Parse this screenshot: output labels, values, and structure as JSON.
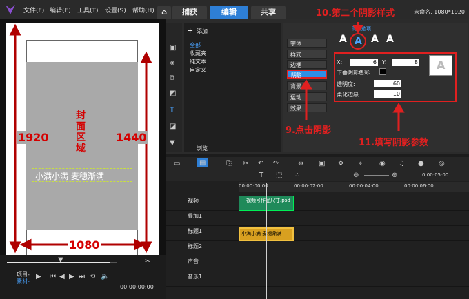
{
  "menu": {
    "file": "文件(F)",
    "edit": "编辑(E)",
    "tools": "工具(T)",
    "settings": "设置(S)",
    "help": "帮助(H)"
  },
  "tabs": {
    "capture": "捕获",
    "edit": "编辑",
    "share": "共享"
  },
  "title_right": "未命名, 1080*1920",
  "preview": {
    "height_left": "1920",
    "height_right": "1440",
    "width_label": "1080",
    "cover_label": "封面区域",
    "caption": "小满小满 麦穗渐满",
    "project": "项目-",
    "material": "素材-",
    "timecode": "00:00:00:00"
  },
  "library": {
    "add": "添加",
    "items": [
      "全部",
      "收藏夹",
      "纯文本",
      "自定义"
    ],
    "browse": "浏览"
  },
  "options": {
    "title": "高级选项",
    "buttons": [
      "字体",
      "样式",
      "边框",
      "阴影",
      "背景",
      "运动",
      "效果"
    ],
    "selected": "阴影",
    "style_letters": [
      "A",
      "A",
      "A",
      "A"
    ],
    "params": {
      "x_label": "X:",
      "x_value": "6",
      "y_label": "Y:",
      "y_value": "8",
      "color_label": "下垂阴影色彩:",
      "opacity_label": "透明度:",
      "opacity_value": "60",
      "soft_label": "柔化边缘:",
      "soft_value": "10"
    }
  },
  "annotations": {
    "a10": "10.第二个阴影样式",
    "a9": "9.点击阴影",
    "a11": "11.填写阴影参数"
  },
  "timeline": {
    "ruler": [
      "00:00:00:00",
      "00:00:02:00",
      "00:00:04:00",
      "00:00:06:00"
    ],
    "tracks": [
      "视频",
      "叠加1",
      "标题1",
      "标题2",
      "声音",
      "音乐1"
    ],
    "clip1": "视频号作品尺寸.psd",
    "clip2": "小满小满 麦穗渐满",
    "zoom_time": "0:00:05:00"
  }
}
